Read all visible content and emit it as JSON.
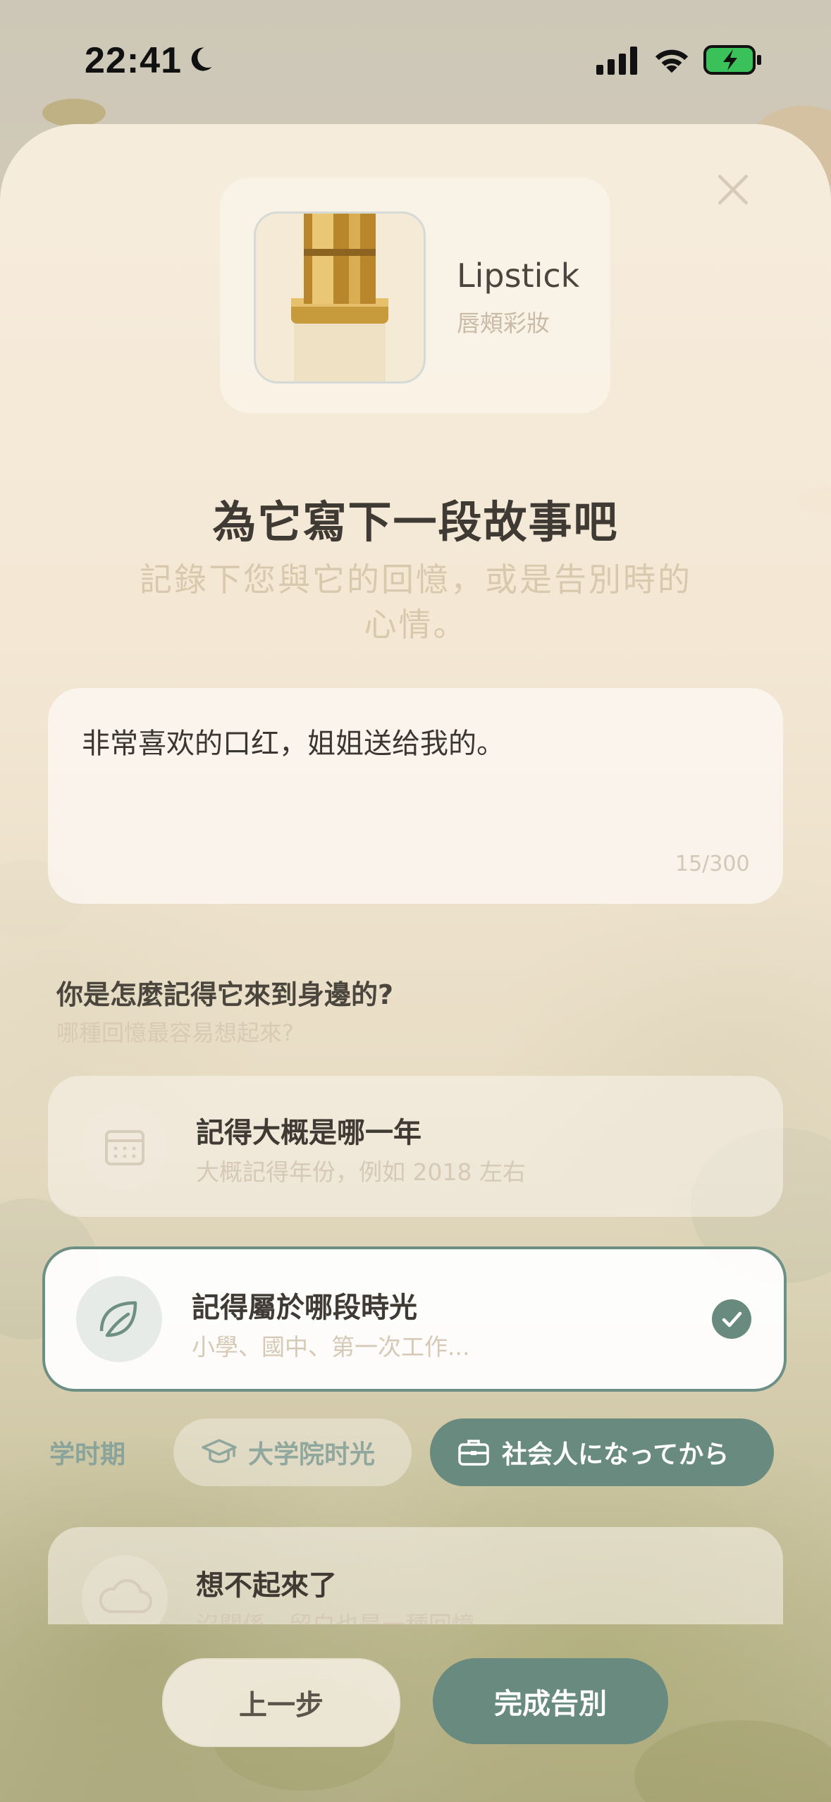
{
  "status_bar": {
    "time": "22:41"
  },
  "product": {
    "name": "Lipstick",
    "category": "唇頰彩妝"
  },
  "heading": {
    "title": "為它寫下一段故事吧",
    "subtitle": "記錄下您與它的回憶，或是告別時的心情。"
  },
  "story": {
    "text": "非常喜欢的口红，姐姐送给我的。",
    "counter": "15/300"
  },
  "question": {
    "title": "你是怎麼記得它來到身邊的?",
    "subtitle": "哪種回憶最容易想起來?"
  },
  "options": [
    {
      "title": "記得大概是哪一年",
      "desc": "大概記得年份，例如 2018 左右",
      "icon": "calendar-icon",
      "selected": false
    },
    {
      "title": "記得屬於哪段時光",
      "desc": "小學、國中、第一次工作...",
      "icon": "leaf-icon",
      "selected": true
    },
    {
      "title": "想不起來了",
      "desc": "沒關係，留白也是一種回憶。",
      "icon": "cloud-icon",
      "selected": false
    }
  ],
  "chips": [
    {
      "label": "学时期",
      "icon": "",
      "selected": false
    },
    {
      "label": "大学院时光",
      "icon": "graduation-cap-icon",
      "selected": false
    },
    {
      "label": "社会人になってから",
      "icon": "briefcase-icon",
      "selected": true
    }
  ],
  "footer": {
    "back_label": "上一步",
    "done_label": "完成告別"
  },
  "colors": {
    "accent": "#688a7f",
    "title": "#3f3a33",
    "muted": "#d8c9ae"
  }
}
